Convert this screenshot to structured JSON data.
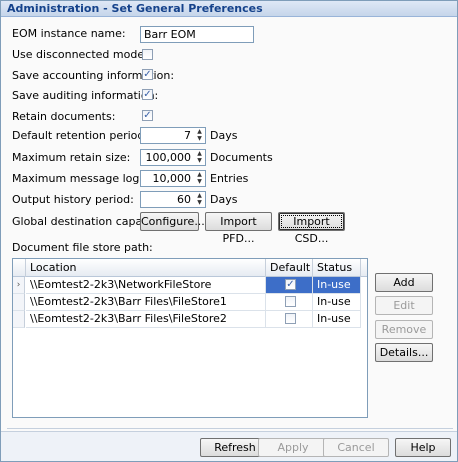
{
  "window": {
    "title": "Administration - Set General Preferences"
  },
  "form": {
    "instance_name_label": "EOM instance name:",
    "instance_name_value": "Barr EOM",
    "disconnected_label": "Use disconnected mode:",
    "disconnected_checked": false,
    "accounting_label": "Save accounting information:",
    "accounting_checked": true,
    "auditing_label": "Save auditing information:",
    "auditing_checked": true,
    "retain_label": "Retain documents:",
    "retain_checked": true,
    "retention_label": "Default retention period:",
    "retention_value": "7",
    "retention_unit": "Days",
    "retain_size_label": "Maximum retain size:",
    "retain_size_value": "100,000",
    "retain_size_unit": "Documents",
    "log_size_label": "Maximum message log size:",
    "log_size_value": "10,000",
    "log_size_unit": "Entries",
    "output_history_label": "Output history period:",
    "output_history_value": "60",
    "output_history_unit": "Days",
    "global_dest_label": "Global destination capabilities:",
    "configure_label": "Configure...",
    "import_pfd_label": "Import PFD...",
    "import_csd_label": "Import CSD..."
  },
  "store": {
    "title": "Document file store path:",
    "columns": [
      "Location",
      "Default",
      "Status"
    ],
    "rows": [
      {
        "location": "\\\\Eomtest2-2k3\\NetworkFileStore",
        "default": true,
        "status": "In-use",
        "selected": true
      },
      {
        "location": "\\\\Eomtest2-2k3\\Barr Files\\FileStore1",
        "default": false,
        "status": "In-use",
        "selected": false
      },
      {
        "location": "\\\\Eomtest2-2k3\\Barr Files\\FileStore2",
        "default": false,
        "status": "In-use",
        "selected": false
      }
    ],
    "add_label": "Add",
    "edit_label": "Edit",
    "remove_label": "Remove",
    "details_label": "Details..."
  },
  "footer": {
    "refresh_label": "Refresh",
    "apply_label": "Apply",
    "cancel_label": "Cancel",
    "help_label": "Help"
  },
  "glyphs": {
    "check": "✓",
    "current_row": "›",
    "spin_up": "▲",
    "spin_down": "▼"
  }
}
